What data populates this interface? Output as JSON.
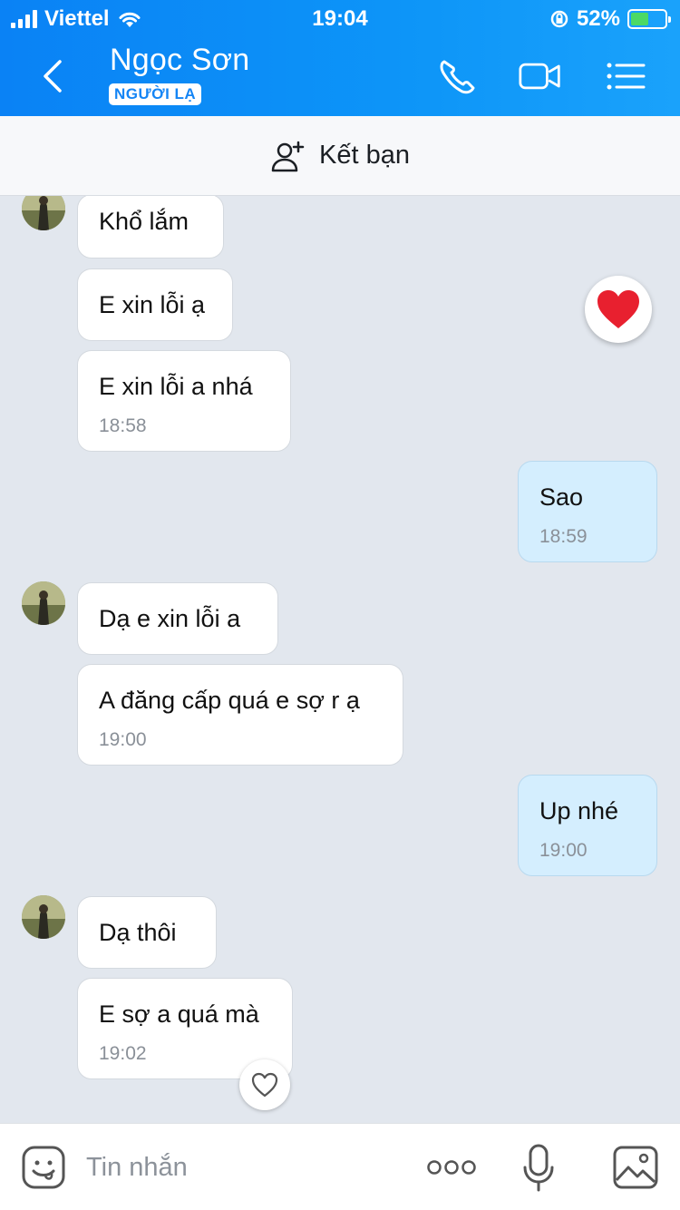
{
  "status_bar": {
    "carrier": "Viettel",
    "time": "19:04",
    "battery": "52%",
    "battery_level": 0.52
  },
  "header": {
    "contact_name": "Ngọc Sơn",
    "tag": "NGƯỜI LẠ",
    "icons": [
      "back-icon",
      "phone-icon",
      "video-call-icon",
      "menu-icon"
    ]
  },
  "add_friend": {
    "label": "Kết bạn",
    "icon": "add-user-icon"
  },
  "messages": [
    {
      "from": "them",
      "text": "Khổ lắm"
    },
    {
      "from": "them",
      "text": "E xin lỗi ạ",
      "reaction": "heart"
    },
    {
      "from": "them",
      "text": "E xin lỗi a nhá",
      "time": "18:58"
    },
    {
      "from": "me",
      "text": "Sao",
      "time": "18:59"
    },
    {
      "from": "them",
      "text": "Dạ e xin lỗi a"
    },
    {
      "from": "them",
      "text": "A đăng cấp quá e sợ r ạ",
      "time": "19:00"
    },
    {
      "from": "me",
      "text": "Up nhé",
      "time": "19:00"
    },
    {
      "from": "them",
      "text": "Dạ thôi"
    },
    {
      "from": "them",
      "text": "E sợ a quá mà",
      "time": "19:02"
    }
  ],
  "input": {
    "placeholder": "Tin nhắn"
  },
  "colors": {
    "header": "#0d95f8",
    "chat_bg": "#e2e7ee",
    "my_bubble": "#d4eefe",
    "heart": "#e8202f"
  }
}
